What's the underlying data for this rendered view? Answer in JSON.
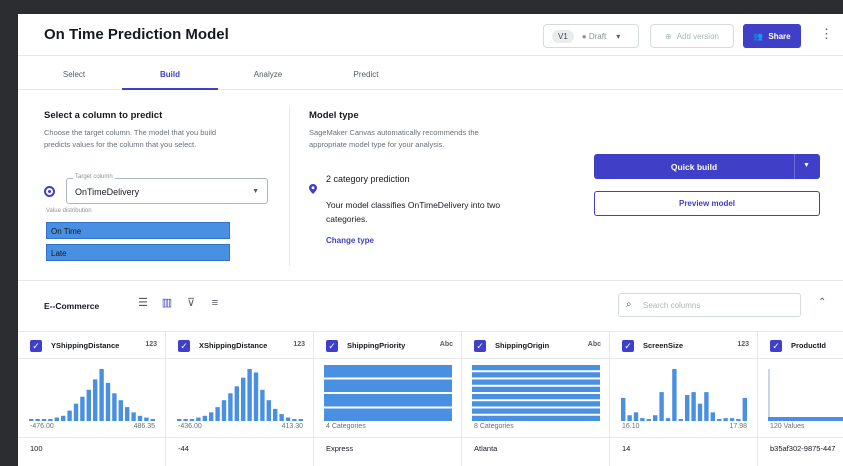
{
  "header": {
    "title": "On Time Prediction Model",
    "version_pill": "V1",
    "version_status": "Draft",
    "add_version": "Add version",
    "share": "Share"
  },
  "tabs": [
    {
      "label": "Select",
      "active": false
    },
    {
      "label": "Build",
      "active": true
    },
    {
      "label": "Analyze",
      "active": false
    },
    {
      "label": "Predict",
      "active": false
    }
  ],
  "target": {
    "heading": "Select a column to predict",
    "description_line1": "Choose the target column. The model that you build",
    "description_line2": "predicts values for the column that you select.",
    "field_label": "Target column",
    "value": "OnTimeDelivery",
    "distribution_label": "Value distribution",
    "distribution": [
      {
        "label": "On Time"
      },
      {
        "label": "Late"
      }
    ]
  },
  "model_type": {
    "heading": "Model type",
    "description_line1": "SageMaker Canvas automatically recommends the",
    "description_line2": "appropriate model type for your analysis.",
    "prediction": "2 category prediction",
    "prediction_desc_line1": "Your model classifies OnTimeDelivery into two",
    "prediction_desc_line2": "categories.",
    "change_type": "Change type"
  },
  "actions": {
    "quick_build": "Quick build",
    "preview_model": "Preview model"
  },
  "dataset": {
    "name": "E--Commerce",
    "search_placeholder": "Search columns"
  },
  "columns": [
    {
      "name": "YShippingDistance",
      "type": "123",
      "chart": "histogram",
      "bins": [
        1,
        1,
        1,
        1,
        2,
        3,
        6,
        10,
        14,
        18,
        24,
        30,
        22,
        16,
        12,
        8,
        5,
        3,
        2,
        1
      ],
      "min": "-476.00",
      "max": "486.35",
      "sample": "100"
    },
    {
      "name": "XShippingDistance",
      "type": "123",
      "chart": "histogram",
      "bins": [
        1,
        1,
        1,
        2,
        3,
        5,
        8,
        12,
        16,
        20,
        25,
        30,
        28,
        18,
        12,
        7,
        4,
        2,
        1,
        1
      ],
      "min": "-436.00",
      "max": "413.30",
      "sample": "-44"
    },
    {
      "name": "ShippingPriority",
      "type": "Abc",
      "chart": "categories",
      "bars": [
        1,
        1,
        1,
        1
      ],
      "footer": "4 Categories",
      "sample": "Express"
    },
    {
      "name": "ShippingOrigin",
      "type": "Abc",
      "chart": "categories",
      "bars": [
        1,
        1,
        1,
        1,
        1,
        1,
        1,
        1
      ],
      "footer": "8 Categories",
      "sample": "Atlanta"
    },
    {
      "name": "ScreenSize",
      "type": "123",
      "chart": "histogram",
      "bins": [
        8,
        2,
        3,
        1,
        0,
        2,
        10,
        1,
        18,
        0,
        9,
        10,
        6,
        10,
        3,
        0,
        1,
        1,
        0,
        8
      ],
      "min": "16.10",
      "max": "17.98",
      "sample": "14"
    },
    {
      "name": "ProductId",
      "type": "",
      "chart": "flat",
      "footer": "120 Values",
      "sample": "b35af302-9875-447"
    }
  ]
}
